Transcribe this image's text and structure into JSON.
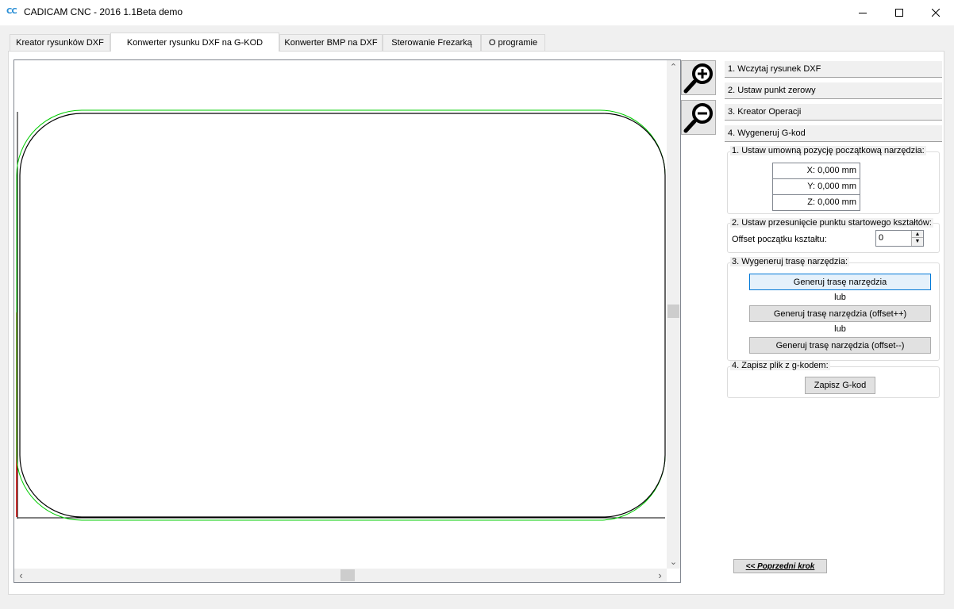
{
  "window": {
    "logo_text": "CC",
    "title": "CADICAM CNC - 2016 1.1Beta demo"
  },
  "tabs": [
    {
      "label": "Kreator rysunków DXF"
    },
    {
      "label": "Konwerter rysunku DXF na G-KOD"
    },
    {
      "label": "Konwerter BMP na DXF"
    },
    {
      "label": "Sterowanie Frezarką"
    },
    {
      "label": "O programie"
    }
  ],
  "steps": [
    {
      "label": "1. Wczytaj rysunek DXF"
    },
    {
      "label": "2. Ustaw punkt zerowy"
    },
    {
      "label": "3. Kreator Operacji"
    },
    {
      "label": "4. Wygeneruj G-kod"
    }
  ],
  "group1": {
    "legend": "1. Ustaw umowną pozycję początkową narzędzia:",
    "x": "X: 0,000 mm",
    "y": "Y: 0,000 mm",
    "z": "Z: 0,000 mm"
  },
  "group2": {
    "legend": "2. Ustaw przesunięcie punktu startowego kształtów:",
    "offset_label": "Offset początku kształtu:",
    "offset_value": "0"
  },
  "group3": {
    "legend": "3. Wygeneruj trasę narzędzia:",
    "btn_generate": "Generuj trasę narzędzia",
    "or1": "lub",
    "btn_offset_plus": "Generuj trasę narzędzia (offset++)",
    "or2": "lub",
    "btn_offset_minus": "Generuj trasę narzędzia (offset--)"
  },
  "group4": {
    "legend": "4. Zapisz plik z g-kodem:",
    "btn_save": "Zapisz G-kod"
  },
  "prev_step": "<< Poprzedni krok",
  "colors": {
    "shape_outline": "#000000",
    "tool_path": "#00cc00",
    "axis_marker": "#cc0000",
    "focus_border": "#0078d7"
  },
  "icons": {
    "zoom_in": "magnifier-plus-icon",
    "zoom_out": "magnifier-minus-icon",
    "minimize": "minimize-icon",
    "maximize": "maximize-icon",
    "close": "close-icon"
  }
}
